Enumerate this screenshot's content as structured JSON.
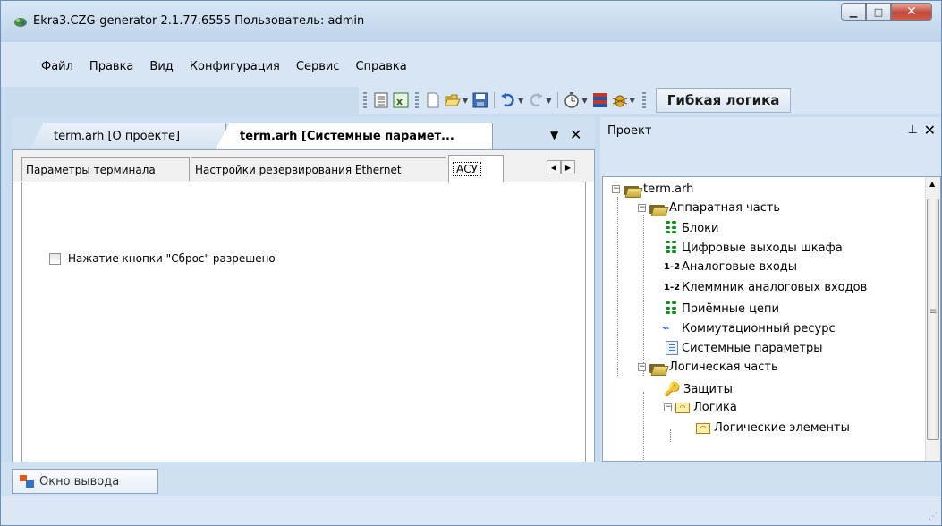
{
  "window": {
    "title": "Ekra3.CZG-generator 2.1.77.6555 Пользователь: admin"
  },
  "menu": {
    "items": [
      "Файл",
      "Правка",
      "Вид",
      "Конфигурация",
      "Сервис",
      "Справка"
    ]
  },
  "toolbar": {
    "icons": [
      "list-icon",
      "excel-icon",
      "new-file-icon",
      "open-folder-icon",
      "save-icon",
      "undo-icon",
      "redo-icon",
      "timer-icon",
      "flags-icon",
      "bug-icon"
    ],
    "tab_label": "Гибкая логика"
  },
  "documents": {
    "tabs": [
      {
        "label": "term.arh [О проекте]",
        "active": false
      },
      {
        "label": "term.arh [Системные парамет...",
        "active": true
      }
    ]
  },
  "properties": {
    "tabs": [
      "Параметры терминала",
      "Настройки резервирования Ethernet",
      "АСУ"
    ],
    "active_tab": "АСУ",
    "checkbox_label": "Нажатие кнопки \"Сброс\" разрешено",
    "checkbox_checked": false
  },
  "project": {
    "title": "Проект",
    "tree": {
      "root": "term.arh",
      "hardware": "Аппаратная часть",
      "blocks": "Блоки",
      "digital_outputs": "Цифровые выходы шкафа",
      "analog_inputs_badge": "1-2",
      "analog_inputs": "Аналоговые входы",
      "terminal_badge": "1-2",
      "terminal": "Клеммник аналоговых входов",
      "receive_circuits": "Приёмные цепи",
      "switching": "Коммутационный ресурс",
      "system_params": "Системные параметры",
      "logical": "Логическая часть",
      "protections": "Защиты",
      "logic": "Логика",
      "logic_elements": "Логические элементы"
    }
  },
  "output": {
    "tab_label": "Окно вывода"
  }
}
